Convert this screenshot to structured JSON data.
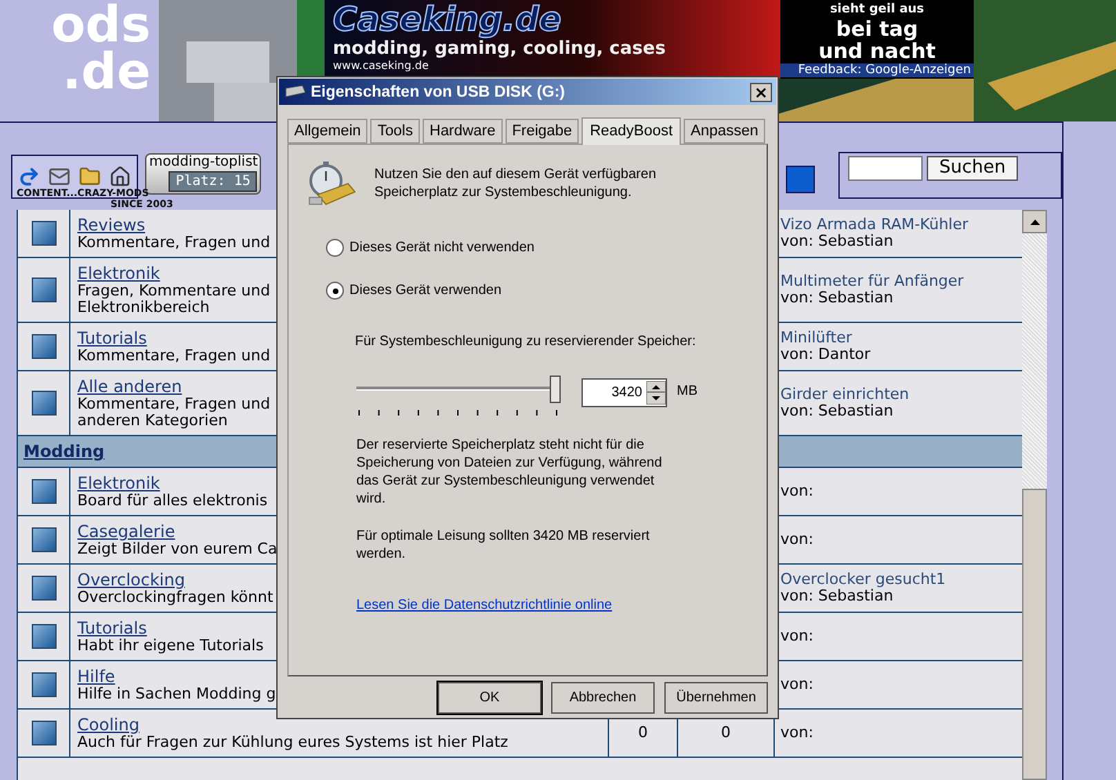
{
  "header": {
    "logo_lines": [
      "ods",
      ".de"
    ],
    "ad": {
      "title": "Caseking.de",
      "tagline": "modding, gaming, cooling, cases",
      "url": "www.caseking.de",
      "slogan": [
        "sieht geil aus",
        "bei tag",
        "und nacht"
      ],
      "feedback": "Feedback: Google-Anzeigen"
    }
  },
  "toolbar": {
    "toplist": {
      "name": "modding-toplist",
      "rank": "Platz: 15"
    },
    "search": {
      "button": "Suchen"
    }
  },
  "tagline": {
    "top": "CONTENT...CRAZY-MODS",
    "bottom": "SINCE 2003"
  },
  "forum": {
    "rows": [
      {
        "kind": "forum",
        "name": "Reviews",
        "desc": "Kommentare, Fragen und",
        "last_title": "Vizo Armada RAM-Kühler",
        "last_by": "von: Sebastian"
      },
      {
        "kind": "forum",
        "name": "Elektronik",
        "desc": "Fragen, Kommentare und\nElektronikbereich",
        "last_title": "Multimeter für Anfänger",
        "last_by": "von: Sebastian"
      },
      {
        "kind": "forum",
        "name": "Tutorials",
        "desc": "Kommentare, Fragen und",
        "last_title": "Minilüfter",
        "last_by": "von: Dantor"
      },
      {
        "kind": "forum",
        "name": "Alle anderen",
        "desc": "Kommentare, Fragen und\nanderen Kategorien",
        "last_title": "Girder einrichten",
        "last_by": "von: Sebastian"
      },
      {
        "kind": "category",
        "name": "Modding"
      },
      {
        "kind": "forum",
        "name": "Elektronik",
        "desc": "Board für alles elektronis",
        "last_by": "von:"
      },
      {
        "kind": "forum",
        "name": "Casegalerie",
        "desc": "Zeigt Bilder von eurem Ca",
        "last_by": "von:"
      },
      {
        "kind": "forum",
        "name": "Overclocking",
        "desc": "Overclockingfragen könnt",
        "last_title": "Overclocker gesucht1",
        "last_by": "von: Sebastian"
      },
      {
        "kind": "forum",
        "name": "Tutorials",
        "desc": "Habt ihr eigene Tutorials",
        "last_by": "von:"
      },
      {
        "kind": "forum",
        "name": "Hilfe",
        "desc": "Hilfe in Sachen Modding g",
        "last_by": "von:"
      },
      {
        "kind": "forum",
        "name": "Cooling",
        "desc": "Auch für Fragen zur Kühlung eures Systems ist hier Platz",
        "topics": "0",
        "posts": "0",
        "last_by": "von:"
      }
    ]
  },
  "dialog": {
    "title": "Eigenschaften von USB DISK (G:)",
    "close": "×",
    "tabs": [
      {
        "label": "Allgemein",
        "selected": false
      },
      {
        "label": "Tools",
        "selected": false
      },
      {
        "label": "Hardware",
        "selected": false
      },
      {
        "label": "Freigabe",
        "selected": false
      },
      {
        "label": "ReadyBoost",
        "selected": true
      },
      {
        "label": "Anpassen",
        "selected": false
      }
    ],
    "intro": "Nutzen Sie den auf diesem Gerät verfügbaren\nSpeicherplatz zur Systembeschleunigung.",
    "options": [
      {
        "label": "Dieses Gerät nicht verwenden",
        "selected": false
      },
      {
        "label": "Dieses Gerät verwenden",
        "selected": true
      }
    ],
    "reserve_label": "Für Systembeschleunigung zu reservierender Speicher:",
    "slider": {
      "level": 0.97
    },
    "amount": {
      "value": "3420",
      "unit": "MB"
    },
    "note": "Der reservierte Speicherplatz steht nicht für die\nSpeicherung von Dateien zur Verfügung, während\ndas Gerät zur Systembeschleunigung verwendet\nwird.",
    "recommendation": "Für optimale Leisung sollten 3420 MB reserviert\nwerden.",
    "link": "Lesen Sie die Datenschutzrichtlinie online",
    "buttons": [
      "OK",
      "Abbrechen",
      "Übernehmen"
    ]
  }
}
